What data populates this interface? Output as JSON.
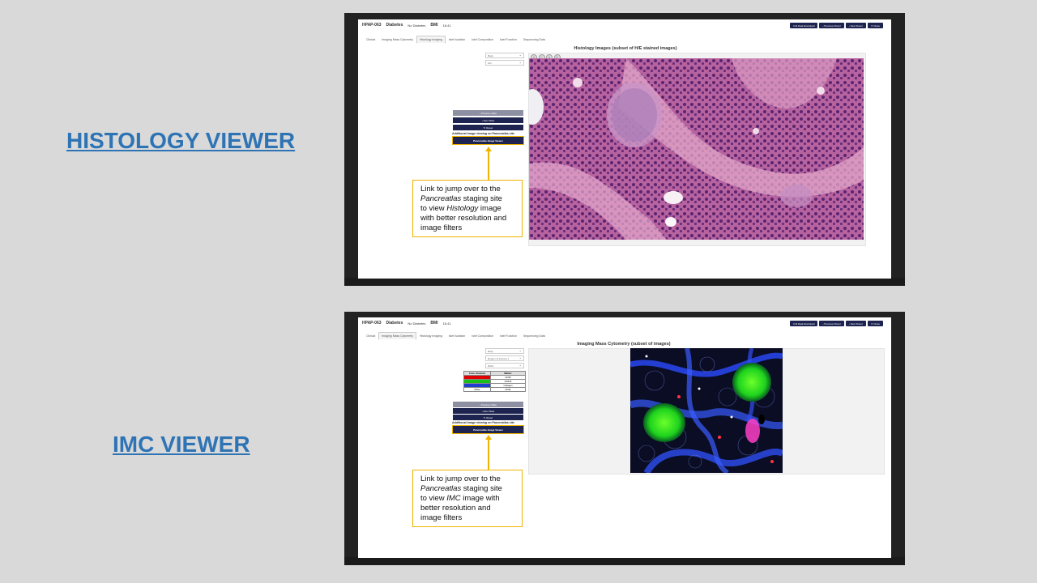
{
  "panels": [
    {
      "section_title": "HISTOLOGY VIEWER",
      "app": {
        "donor_id": "HPAP-063",
        "diabetes_label": "Diabetes",
        "diabetes_value": "No Diabetes",
        "bmi_label": "BMI",
        "bmi_value": "18.41",
        "header_buttons": [
          "Full Data Download",
          "‹ Previous Donor",
          "› Next Donor",
          "✕ Close"
        ],
        "tabs": [
          "Clinical",
          "Imaging Mass Cytometry",
          "Histology Imaging",
          "Islet Isolation",
          "Islet Composition",
          "Islet Function",
          "Sequencing Data"
        ],
        "active_tab": 2,
        "viewer_title": "Histology Images (subset of H/E stained images)",
        "selects": [
          "Body",
          "10x"
        ],
        "nav_buttons": [
          "‹ Previous Slide",
          "› Next Slide",
          "↻ Reset"
        ],
        "additional_label": "Additional image viewing on Pancreatlas site",
        "pancreatlas_button": "Pancreatlas Image Viewer"
      },
      "callout": {
        "line1": "Link to jump over to the",
        "line2_em": "Pancreatlas",
        "line2_rest": " staging site",
        "line3_pre": "to view ",
        "line3_em": "Histology",
        "line3_post": " image",
        "line4": "with better resolution and",
        "line5": "image filters"
      }
    },
    {
      "section_title": "IMC VIEWER",
      "app": {
        "donor_id": "HPAP-063",
        "diabetes_label": "Diabetes",
        "diabetes_value": "No Diabetes",
        "bmi_label": "BMI",
        "bmi_value": "18.41",
        "header_buttons": [
          "Full Data Download",
          "‹ Previous Donor",
          "› Next Donor",
          "✕ Close"
        ],
        "tabs": [
          "Clinical",
          "Imaging Mass Cytometry",
          "Histology Imaging",
          "Islet Isolation",
          "Islet Composition",
          "Islet Function",
          "Sequencing Data"
        ],
        "active_tab": 1,
        "viewer_title": "Imaging Mass Cytometry (subset of images)",
        "selects": [
          "Body",
          "Region of Interest 1",
          "ROI4"
        ],
        "legend_headers": [
          "Color channels",
          "Marker"
        ],
        "legend_rows": [
          {
            "color_name": "Red",
            "color": "#e00000",
            "marker": "CD45"
          },
          {
            "color_name": "Green",
            "color": "#18c018",
            "marker": "CD44b"
          },
          {
            "color_name": "Blue",
            "color": "#1f3fd0",
            "marker": "Collagen"
          },
          {
            "color_name": "White",
            "color": "#ffffff",
            "marker": "CD31"
          }
        ],
        "nav_buttons": [
          "‹ Previous Slide",
          "› Next Slide",
          "↻ Reset"
        ],
        "additional_label": "Additional image viewing on Pancreatlas site",
        "pancreatlas_button": "Pancreatlas Image Viewer"
      },
      "callout": {
        "line1": "Link to jump over to the",
        "line2_em": "Pancreatlas",
        "line2_rest": " staging site",
        "line3_pre": "to view ",
        "line3_em": "IMC",
        "line3_post": "  image with",
        "line4": "better resolution and",
        "line5": "image filters"
      }
    }
  ]
}
